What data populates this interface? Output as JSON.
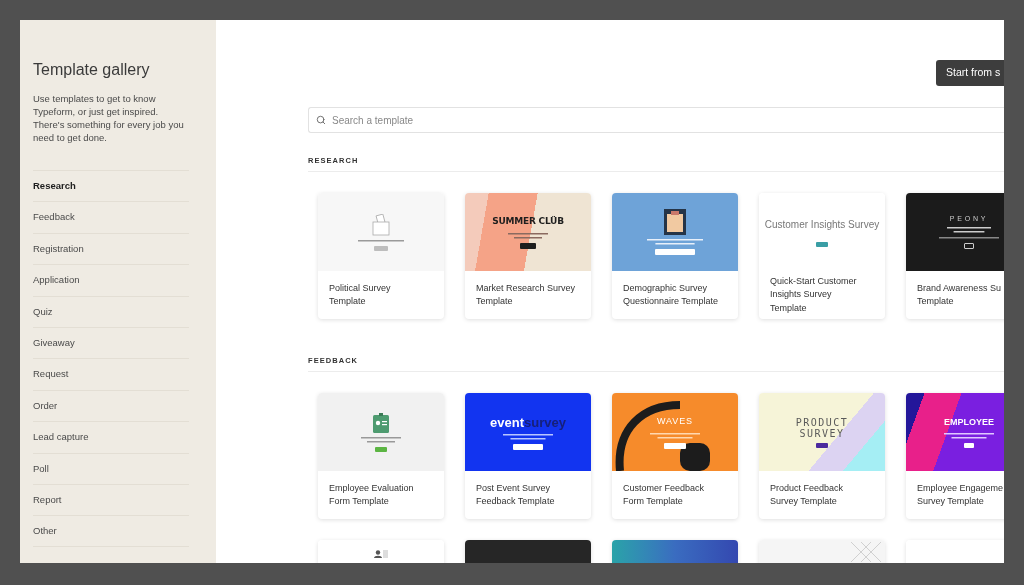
{
  "sidebar": {
    "title": "Template gallery",
    "description": "Use templates to get to know Typeform, or just get inspired. There's something for every job you need to get done.",
    "items": [
      {
        "label": "Research",
        "selected": true
      },
      {
        "label": "Feedback",
        "selected": false
      },
      {
        "label": "Registration",
        "selected": false
      },
      {
        "label": "Application",
        "selected": false
      },
      {
        "label": "Quiz",
        "selected": false
      },
      {
        "label": "Giveaway",
        "selected": false
      },
      {
        "label": "Request",
        "selected": false
      },
      {
        "label": "Order",
        "selected": false
      },
      {
        "label": "Lead capture",
        "selected": false
      },
      {
        "label": "Poll",
        "selected": false
      },
      {
        "label": "Report",
        "selected": false
      },
      {
        "label": "Other",
        "selected": false
      }
    ]
  },
  "header": {
    "button": "Start from s"
  },
  "search": {
    "placeholder": "Search a template"
  },
  "sections": [
    {
      "heading": "RESEARCH",
      "cards": [
        {
          "title": [
            "Political Survey",
            "Template"
          ],
          "preview": {
            "kind": "ballot"
          }
        },
        {
          "title": [
            "Market Research Survey",
            "Template"
          ],
          "preview": {
            "kind": "summer",
            "headline": [
              "SUMMER CLÜB"
            ]
          }
        },
        {
          "title": [
            "Demographic Survey",
            "Questionnaire Template"
          ],
          "preview": {
            "kind": "clipboard"
          }
        },
        {
          "title": [
            "Quick-Start Customer",
            "Insights Survey",
            "Template"
          ],
          "preview": {
            "kind": "insights",
            "headline": [
              "Customer Insights Survey"
            ]
          }
        },
        {
          "title": [
            "Brand Awareness Su",
            "Template"
          ],
          "preview": {
            "kind": "peony",
            "headline": [
              "PEONY"
            ]
          }
        }
      ]
    },
    {
      "heading": "FEEDBACK",
      "cards": [
        {
          "title": [
            "Employee Evaluation",
            "Form Template"
          ],
          "preview": {
            "kind": "badge"
          }
        },
        {
          "title": [
            "Post Event Survey",
            "Feedback Template"
          ],
          "preview": {
            "kind": "event",
            "headline": [
              "event",
              "survey"
            ]
          }
        },
        {
          "title": [
            "Customer Feedback",
            "Form Template"
          ],
          "preview": {
            "kind": "waves",
            "headline": [
              "WAVES"
            ]
          }
        },
        {
          "title": [
            "Product Feedback",
            "Survey Template"
          ],
          "preview": {
            "kind": "product",
            "headline": [
              "PRODUCT",
              "SURVEY"
            ]
          }
        },
        {
          "title": [
            "Employee Engageme",
            "Survey Template"
          ],
          "preview": {
            "kind": "employee",
            "headline": [
              "EMPLOYEE"
            ]
          }
        },
        {
          "preview": {
            "kind": "people"
          }
        },
        {
          "preview": {
            "kind": "dark"
          }
        },
        {
          "preview": {
            "kind": "gradient"
          }
        },
        {
          "preview": {
            "kind": "pattern"
          }
        },
        {
          "preview": {
            "kind": "blank"
          }
        }
      ]
    }
  ]
}
